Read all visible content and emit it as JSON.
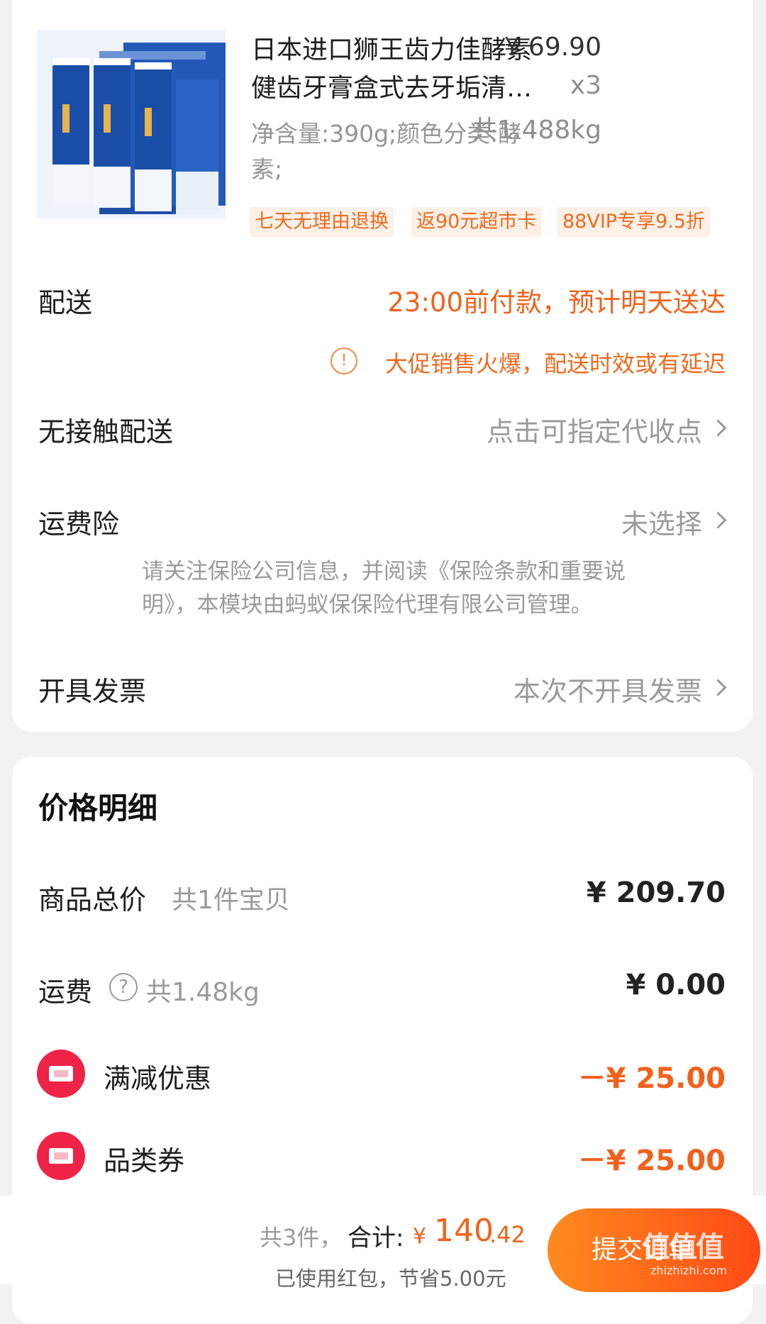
{
  "product": {
    "image_icon": "toothpaste-product-image",
    "title_line1": "日本进口狮王齿力佳酵素",
    "title_line2": "健齿牙膏盒式去牙垢清…",
    "price": "¥ 69.90",
    "quantity": "x3",
    "weight": "共1.488kg",
    "spec_line1": "净含量:390g;颜色分类:酵",
    "spec_line2": "素;",
    "tags": [
      "七天无理由退换",
      "返90元超市卡",
      "88VIP专享9.5折"
    ]
  },
  "delivery": {
    "label": "配送",
    "value": "23:00前付款，预计明天送达",
    "notice": "大促销售火爆，配送时效或有延迟"
  },
  "contactless": {
    "label": "无接触配送",
    "value": "点击可指定代收点"
  },
  "shipping_insurance": {
    "label": "运费险",
    "value": "未选择",
    "note_line1": "请关注保险公司信息，并阅读《保险条款和重要说",
    "note_line2": "明》，本模块由蚂蚁保保险代理有限公司管理。"
  },
  "invoice": {
    "label": "开具发票",
    "value": "本次不开具发票"
  },
  "price_detail": {
    "title": "价格明细",
    "goods_total_label": "商品总价",
    "goods_total_sub": "共1件宝贝",
    "goods_total_value": "¥ 209.70",
    "shipping_label": "运费",
    "shipping_sub": "共1.48kg",
    "shipping_value": "¥ 0.00",
    "full_reduction_label": "满减优惠",
    "full_reduction_value": "－¥ 25.00",
    "category_coupon_label": "品类券",
    "category_coupon_value": "－¥ 25.00"
  },
  "bottom": {
    "count_text": "共3件，",
    "total_label": "合计:",
    "currency": "¥",
    "total_int": "140",
    "total_dec": ".42",
    "savings_text": "已使用红包，节省5.00元",
    "submit_label": "提交订单"
  },
  "watermark": {
    "logo_text": "值值值",
    "url": "zhizhizhi.com"
  },
  "colors": {
    "accent_orange": "#f0621c",
    "tag_background": "#fdf0e6",
    "coupon_icon_red": "#ee2347",
    "submit_gradient_start": "#ff8a1e",
    "submit_gradient_end": "#ff4a17"
  }
}
